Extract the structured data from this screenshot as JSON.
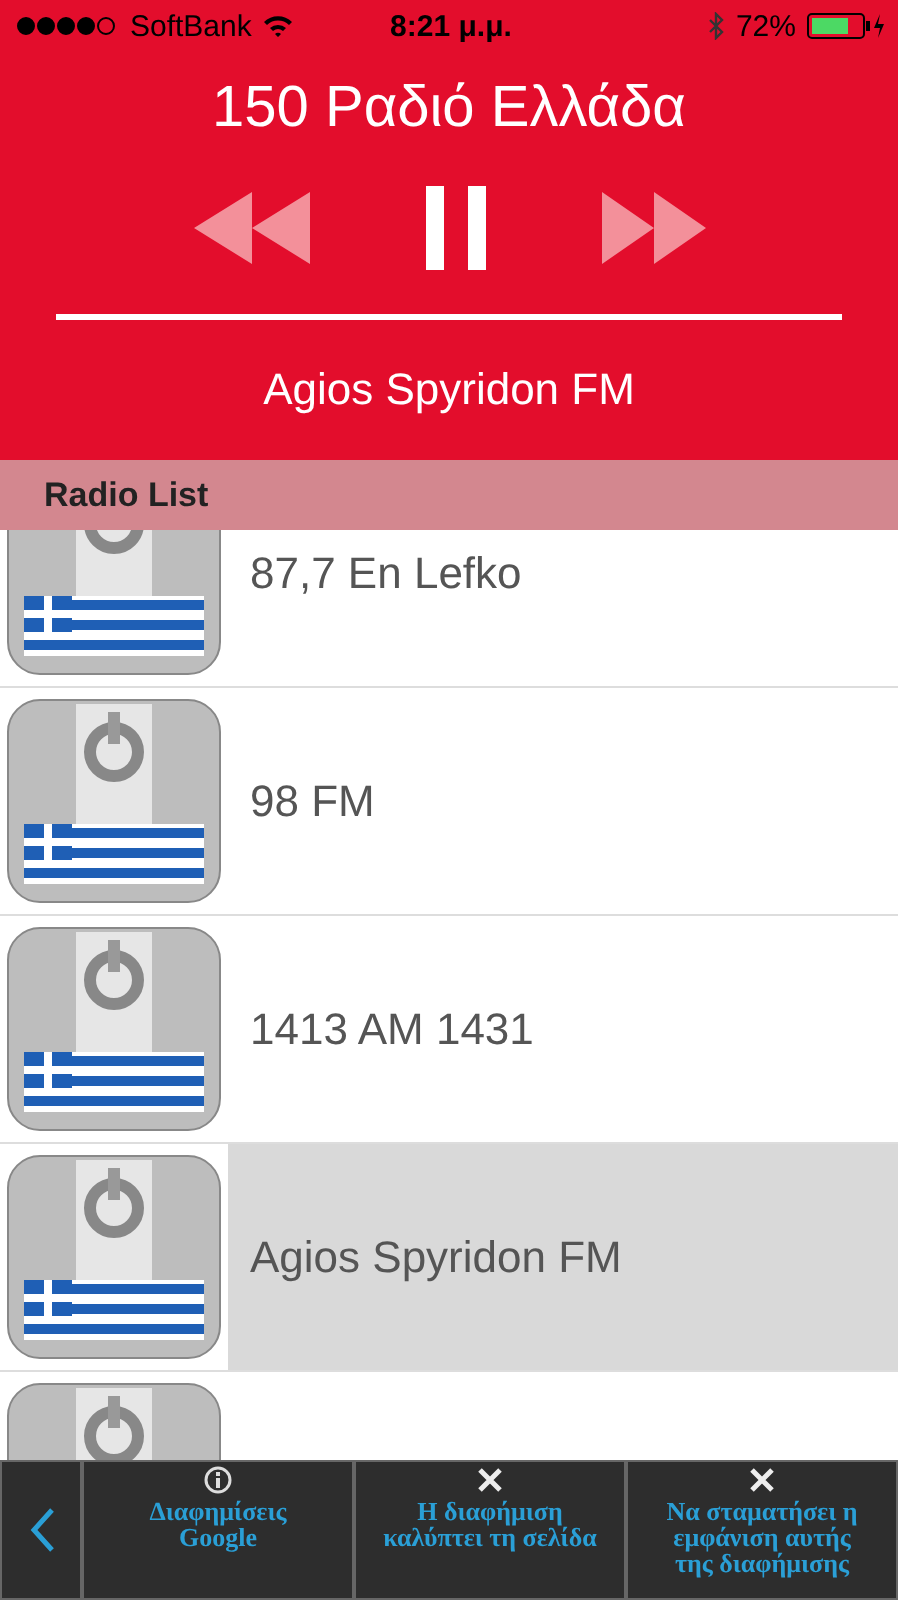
{
  "status_bar": {
    "carrier": "SoftBank",
    "time": "8:21 μ.μ.",
    "battery": "72%"
  },
  "player": {
    "title": "150 Ραδιό Ελλάδα",
    "playing": true,
    "now_playing": "Agios Spyridon FM"
  },
  "list": {
    "header": "Radio List",
    "items": [
      {
        "name": "87,7 En Lefko",
        "selected": false
      },
      {
        "name": "98 FM",
        "selected": false
      },
      {
        "name": "1413 AM 1431",
        "selected": false
      },
      {
        "name": "Agios Spyridon FM",
        "selected": true
      },
      {
        "selected": false
      }
    ]
  },
  "ad_bar": {
    "buttons": [
      {
        "kind": "info",
        "label": "Διαφημίσεις Google"
      },
      {
        "kind": "close",
        "label": "Η διαφήμιση καλύπτει τη σελίδα"
      },
      {
        "kind": "close",
        "label": "Να σταματήσει η εμφάνιση αυτής της διαφήμισης"
      }
    ]
  }
}
